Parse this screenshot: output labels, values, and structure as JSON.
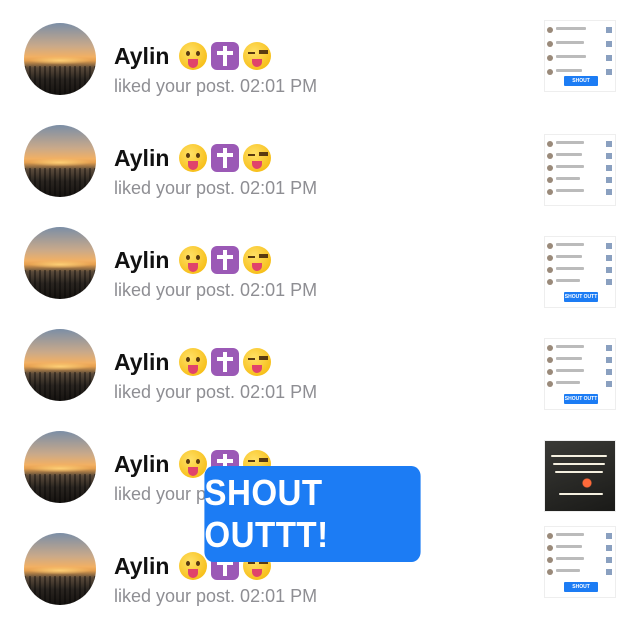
{
  "notifications": [
    {
      "name": "Aylin",
      "action": "liked your post. 02:01 PM",
      "thumb_chip": "SHOUT OUTT!",
      "thumb_style": "list"
    },
    {
      "name": "Aylin",
      "action": "liked your post. 02:01 PM",
      "thumb_chip": "",
      "thumb_style": "list"
    },
    {
      "name": "Aylin",
      "action": "liked your post. 02:01 PM",
      "thumb_chip": "SHOUT OUTT",
      "thumb_style": "list"
    },
    {
      "name": "Aylin",
      "action": "liked your post. 02:01 PM",
      "thumb_chip": "SHOUT OUTT",
      "thumb_style": "list"
    },
    {
      "name": "Aylin",
      "action": "liked your post. 02:01 PM",
      "thumb_chip": "",
      "thumb_style": "photo"
    },
    {
      "name": "Aylin",
      "action": "liked your post. 02:01 PM",
      "thumb_chip": "SHOUT OUTT!!",
      "thumb_style": "list"
    }
  ],
  "emojis": [
    "tongue-face",
    "latin-cross",
    "winking-tongue-face"
  ],
  "overlay": {
    "label": "SHOUT OUTTT!",
    "color": "#1c7cf4"
  }
}
